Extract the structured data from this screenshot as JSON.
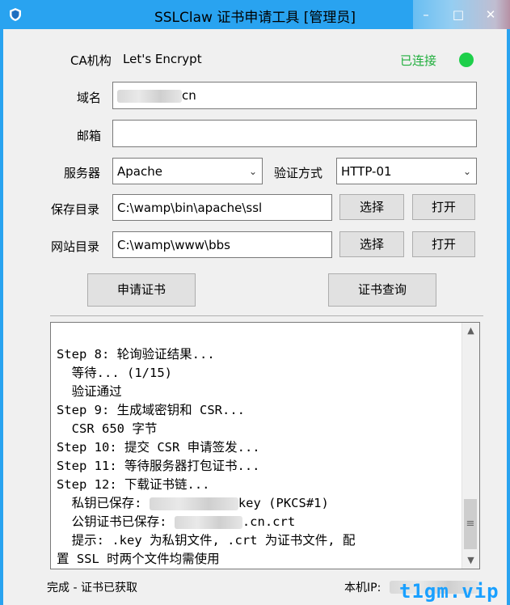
{
  "window": {
    "title": "SSLClaw 证书申请工具 [管理员]"
  },
  "ca": {
    "label": "CA机构",
    "value": "Let's Encrypt",
    "status_text": "已连接",
    "status_color": "#1ecf4a"
  },
  "form": {
    "domain_label": "域名",
    "domain_suffix": "cn",
    "email_label": "邮箱",
    "email_value": "",
    "server_label": "服务器",
    "server_value": "Apache",
    "verify_label": "验证方式",
    "verify_value": "HTTP-01",
    "save_dir_label": "保存目录",
    "save_dir_value": "C:\\wamp\\bin\\apache\\ssl",
    "site_dir_label": "网站目录",
    "site_dir_value": "C:\\wamp\\www\\bbs",
    "choose_label": "选择",
    "open_label": "打开"
  },
  "actions": {
    "apply_label": "申请证书",
    "query_label": "证书查询"
  },
  "log": {
    "line1": "Step 8: 轮询验证结果...",
    "line2": "  等待... (1/15)",
    "line3": "  验证通过",
    "line4": "Step 9: 生成域密钥和 CSR...",
    "line5": "  CSR 650 字节",
    "line6": "Step 10: 提交 CSR 申请签发...",
    "line7": "Step 11: 等待服务器打包证书...",
    "line8": "Step 12: 下载证书链...",
    "line9_prefix": "  私钥已保存: ",
    "line9_suffix": "key (PKCS#1)",
    "line10_prefix": "  公钥证书已保存: ",
    "line10_suffix": ".cn.crt",
    "line11": "  提示: .key 为私钥文件, .crt 为证书文件, 配",
    "line12": "置 SSL 时两个文件均需使用"
  },
  "statusbar": {
    "left": "完成 - 证书已获取",
    "ip_label": "本机IP:"
  },
  "watermark": "t1gm.vip"
}
